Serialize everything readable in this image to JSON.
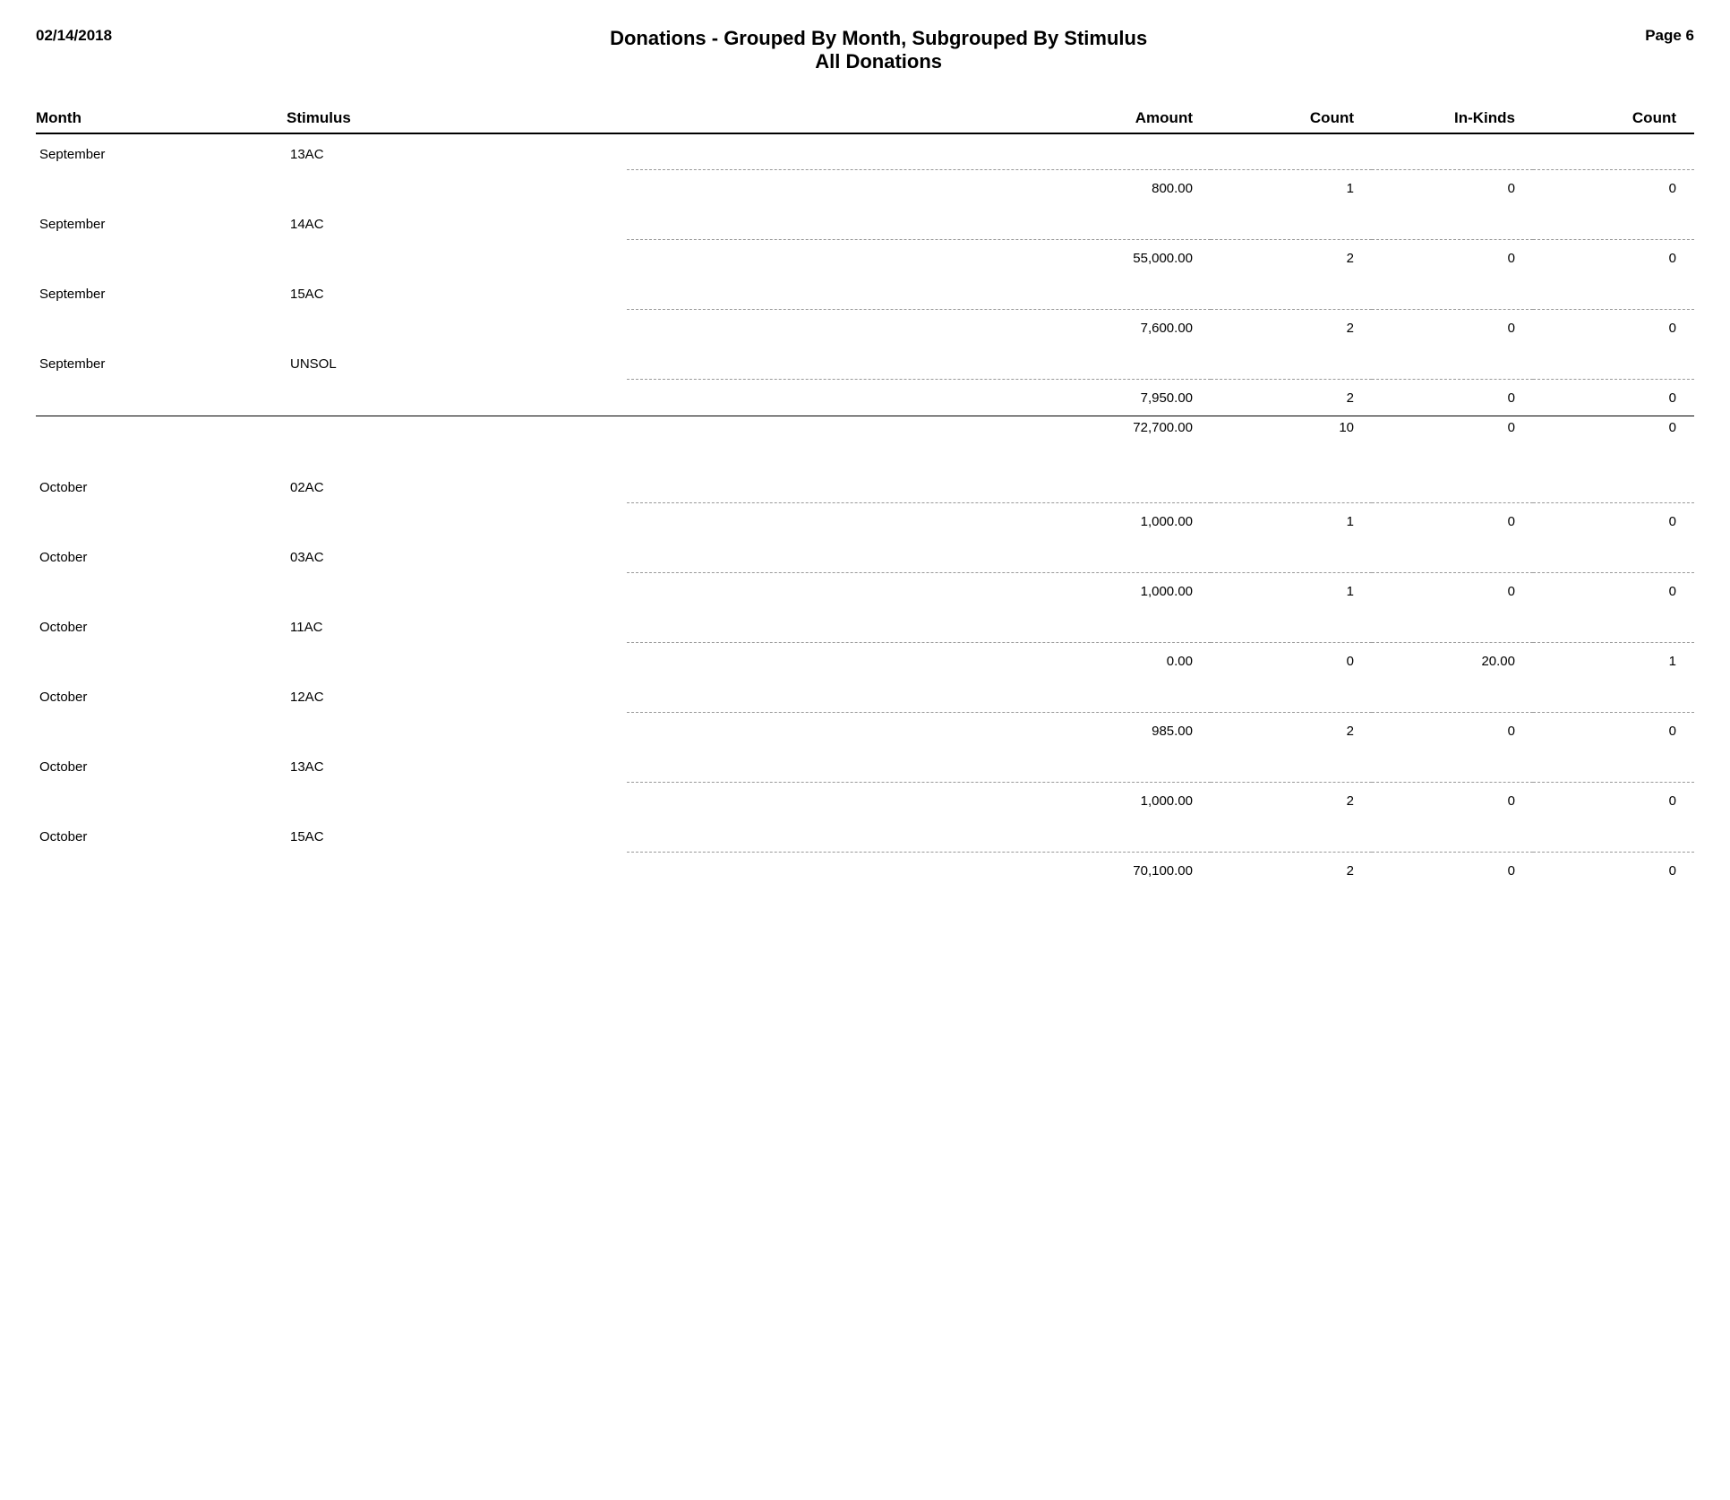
{
  "header": {
    "date": "02/14/2018",
    "title_main": "Donations - Grouped By Month, Subgrouped By Stimulus",
    "title_sub": "All Donations",
    "page": "Page 6"
  },
  "columns": {
    "month": "Month",
    "stimulus": "Stimulus",
    "amount": "Amount",
    "count1": "Count",
    "inkinds": "In-Kinds",
    "count2": "Count"
  },
  "rows": [
    {
      "month": "September",
      "stimulus": "13AC",
      "amount": "800.00",
      "count": "1",
      "inkinds": "0",
      "count2": "0",
      "type": "data"
    },
    {
      "month": "September",
      "stimulus": "14AC",
      "amount": "55,000.00",
      "count": "2",
      "inkinds": "0",
      "count2": "0",
      "type": "data"
    },
    {
      "month": "September",
      "stimulus": "15AC",
      "amount": "7,600.00",
      "count": "2",
      "inkinds": "0",
      "count2": "0",
      "type": "data"
    },
    {
      "month": "September",
      "stimulus": "UNSOL",
      "amount": "7,950.00",
      "count": "2",
      "inkinds": "0",
      "count2": "0",
      "type": "data"
    },
    {
      "month": "",
      "stimulus": "",
      "amount": "72,700.00",
      "count": "10",
      "inkinds": "0",
      "count2": "0",
      "type": "subtotal"
    },
    {
      "month": "October",
      "stimulus": "02AC",
      "amount": "1,000.00",
      "count": "1",
      "inkinds": "0",
      "count2": "0",
      "type": "data"
    },
    {
      "month": "October",
      "stimulus": "03AC",
      "amount": "1,000.00",
      "count": "1",
      "inkinds": "0",
      "count2": "0",
      "type": "data"
    },
    {
      "month": "October",
      "stimulus": "11AC",
      "amount": "0.00",
      "count": "0",
      "inkinds": "20.00",
      "count2": "1",
      "type": "data"
    },
    {
      "month": "October",
      "stimulus": "12AC",
      "amount": "985.00",
      "count": "2",
      "inkinds": "0",
      "count2": "0",
      "type": "data"
    },
    {
      "month": "October",
      "stimulus": "13AC",
      "amount": "1,000.00",
      "count": "2",
      "inkinds": "0",
      "count2": "0",
      "type": "data"
    },
    {
      "month": "October",
      "stimulus": "15AC",
      "amount": "70,100.00",
      "count": "2",
      "inkinds": "0",
      "count2": "0",
      "type": "data"
    }
  ]
}
